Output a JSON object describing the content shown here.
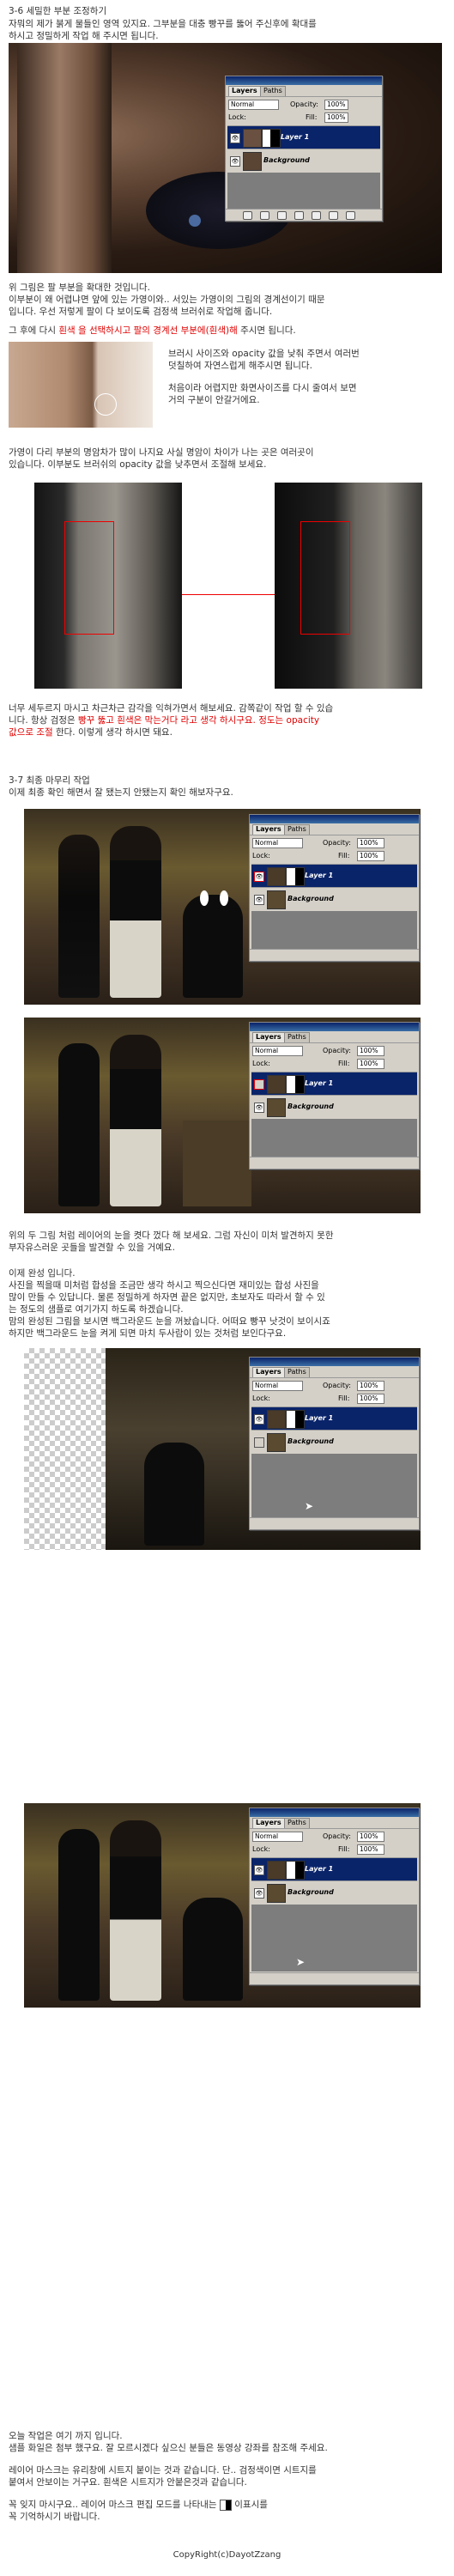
{
  "section1": {
    "heading": "3-6 세밀한 부분 조정하기",
    "intro": "자뭐의 제가 붉게 물들인 영역 있지요. 그부분을 대충 빵꾸를 뚫어 주신후에 확대를\n하시고   정밀하게 작업 해 주시면 됩니다.",
    "para1": "위 그림은 팔 부분을 확대한 것입니다.\n이부분이 왜 어렵냐면 앞에 있는 가영이와.. 서있는 가영이의 그림의 경계선이기 때문\n입니다. 우선 저렇게 팔이 다 보이도록 검정색 브러쉬로 작업해 줍니다.",
    "para2_pre": "그 후에 다시 ",
    "para2_red": "흰색 을 선택하시고 팔의 경계선 부분에(흰색)해",
    "para2_post": " 주시면 됩니다.",
    "side1": "브러시 사이즈와 opacity 값을 낮춰 주면서 여러번\n덧칠하여 자연스럽게 해주시면 됩니다.",
    "side2": "처음이라 어렵지만 화면사이즈를 다시 줄여서 보면\n거의 구분이 안갈거에요.",
    "para3": "가영이 다리 부분의 명암차가 많이 나지요 사실 명암이 차이가 나는 곳은 여러곳이\n있습니다. 이부분도 브러쉬의 opacity 값을 낮추면서 조절해 보세요.",
    "para4_a": "너무 세두르지 마시고 차근차근 감각을 익혀가면서 해보세요. 감쪽같이 작업 할 수 있습\n니다. 항상 검정은 ",
    "para4_red1": "빵꾸 뚫고 흰색은 막는거다 라고 생각 하시구요. 정도는 opacity\n값으로 조절",
    "para4_b": " 한다. 이렇게 생각 하시면 돼요."
  },
  "section2": {
    "heading": "3-7 최종 마무리 작업",
    "intro": "이제 최종 확인 해면서 잘 됐는지 안됐는지 확인 해보자구요.",
    "para1": "위의 두 그림 처럼 레이어의 눈을 켯다 껐다 해 보세요. 그럼 자신이 미처 발견하지 못한\n부자유스러운 곳들을 발견할 수 있을 거예요.",
    "para2": "이제 완성 입니다.\n사진을 찍을때 미처럼 합성을 조금만 생각 하시고 찍으신다면 재미있는 합성 사진을\n많이 만들 수 있답니다. 물론 정밀하게 하자면 끝은 없지만, 초보자도 따라서 할 수 있\n는 정도의 샘플로 여기가지 하도록 하겠습니다.\n맘의 완성된 그림을 보시면 백그라운드 눈을 꺼놨습니다. 어떠요 빵꾸 낫것이 보이시죠\n하지만 백그라운드 눈을 켜게 되면 마치 두사람이 있는 것처럼 보인다구요.",
    "para3": "오늘 작업은 여기 까지 입니다.\n샘플 화일은 첨부 했구요. 잘 모르시겠다 싶으신 분들은 동영상 강좌를 참조해 주세요.",
    "para4": "레이어 마스크는 유리창에 시트지 붙이는 것과 같습니다. 단.. 검정색이면 시트지를\n붙여서 안보이는 거구요. 흰색은 시트지가 안붙은것과 같습니다.",
    "para5_a": "꼭 잊지 마시구요.. 레이어 마스크 편집 모드를 나타내는 ",
    "para5_b": " 이표시를\n꼭 기억하시기 바랍니다."
  },
  "panel": {
    "tab_layers": "Layers",
    "tab_paths": "Paths",
    "blend_mode": "Normal",
    "opacity_label": "Opacity:",
    "opacity_value": "100%",
    "lock_label": "Lock:",
    "fill_label": "Fill:",
    "fill_value": "100%",
    "layer1": "Layer 1",
    "background": "Background"
  },
  "footer": {
    "copyright": "CopyRight(c)DayotZzang"
  },
  "colors": {
    "accent_red": "#e00000",
    "panel_gray": "#d4d0c8",
    "selected_layer": "#0a246a"
  }
}
